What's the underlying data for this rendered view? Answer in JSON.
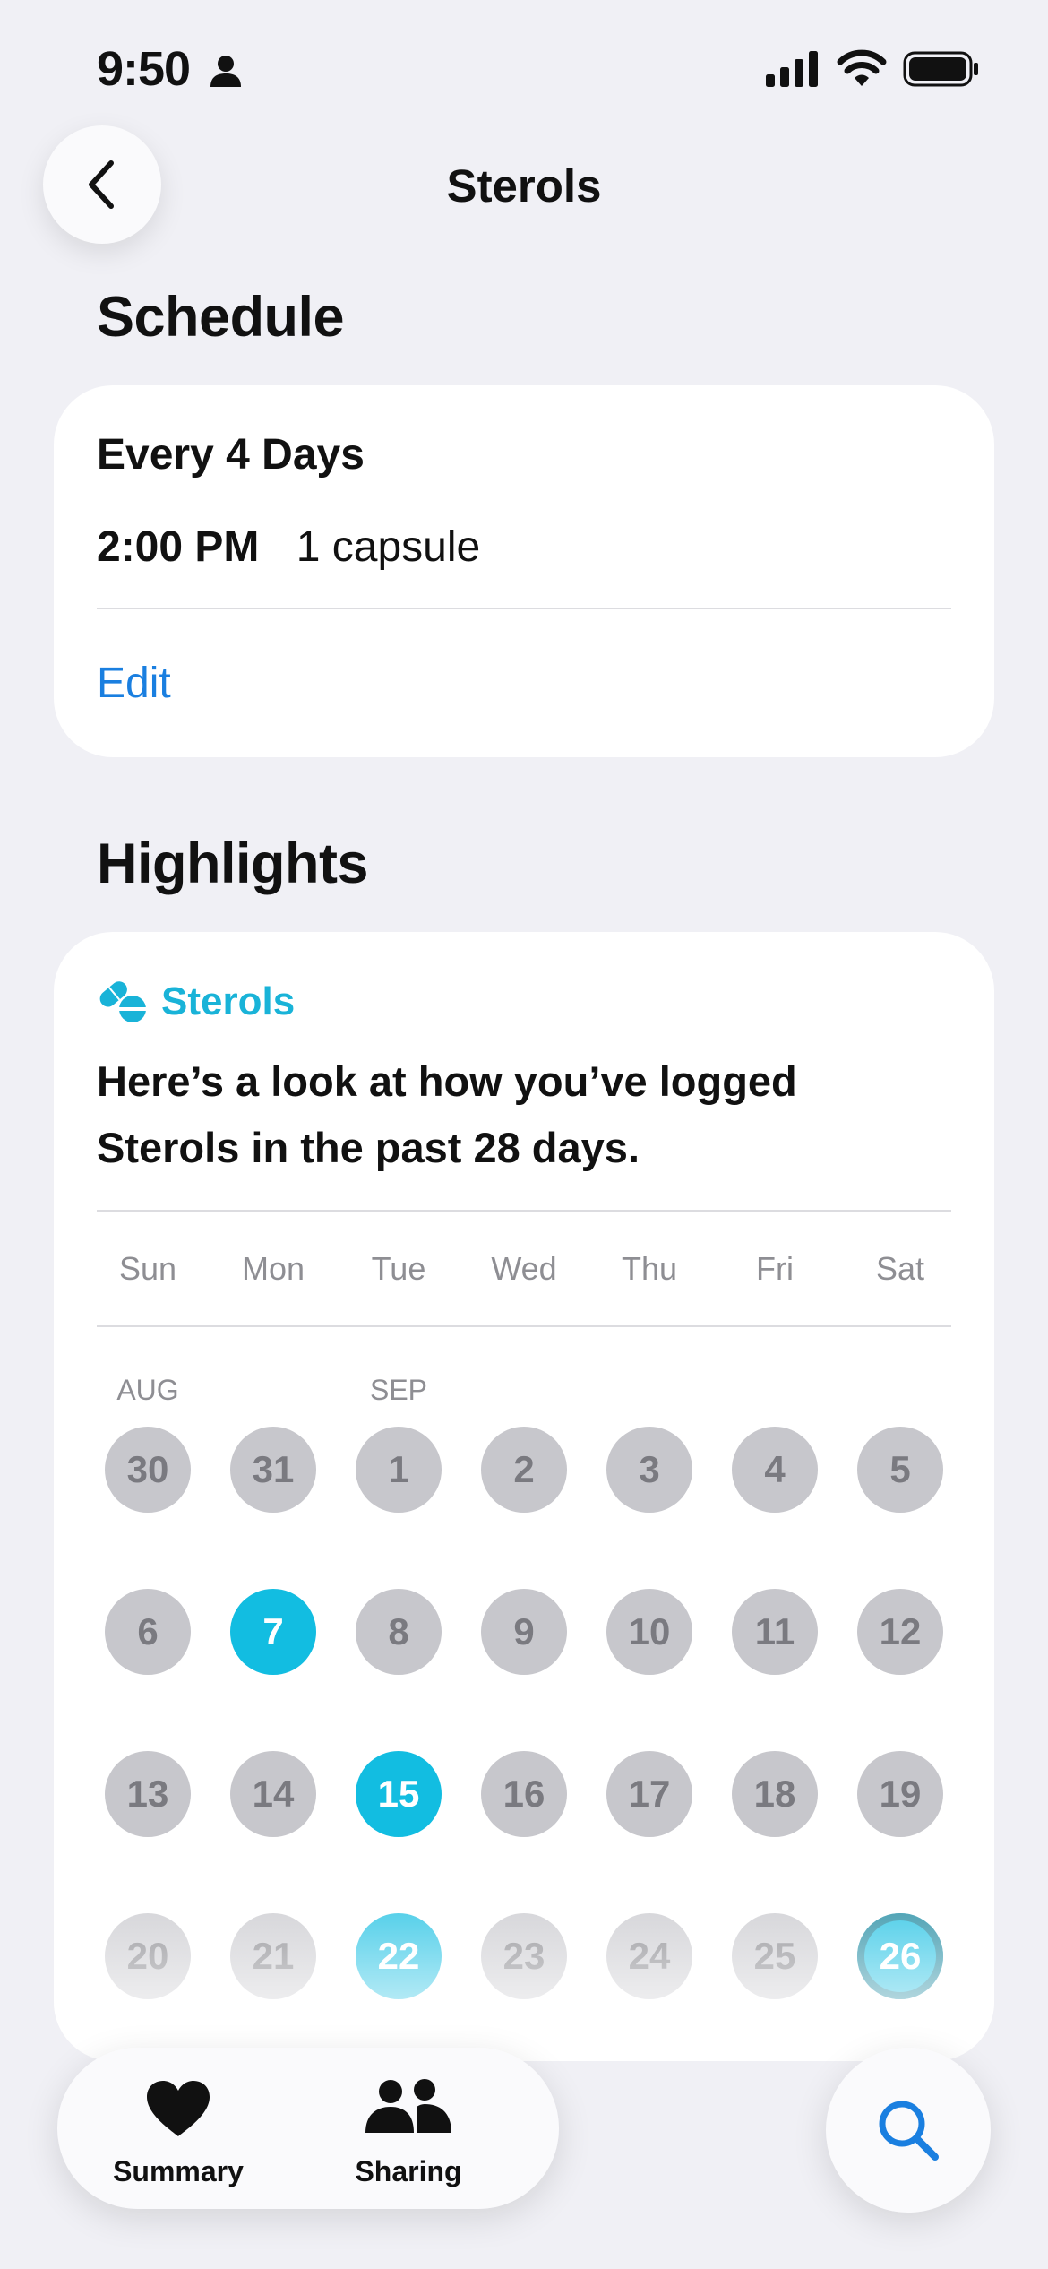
{
  "status_bar": {
    "time": "9:50"
  },
  "nav": {
    "title": "Sterols"
  },
  "schedule": {
    "section_title": "Schedule",
    "frequency": "Every 4 Days",
    "dose_time": "2:00 PM",
    "dose_amount": "1 capsule",
    "edit_label": "Edit"
  },
  "highlights": {
    "section_title": "Highlights",
    "medication_label": "Sterols",
    "description": "Here’s a look at how you’ve logged Sterols in the past 28 days.",
    "weekdays": [
      "Sun",
      "Mon",
      "Tue",
      "Wed",
      "Thu",
      "Fri",
      "Sat"
    ],
    "month_labels": [
      "AUG",
      "SEP"
    ],
    "weeks": [
      [
        "30",
        "31",
        "1",
        "2",
        "3",
        "4",
        "5"
      ],
      [
        "6",
        "7",
        "8",
        "9",
        "10",
        "11",
        "12"
      ],
      [
        "13",
        "14",
        "15",
        "16",
        "17",
        "18",
        "19"
      ],
      [
        "20",
        "21",
        "22",
        "23",
        "24",
        "25",
        "26"
      ]
    ],
    "logged_days": [
      "7",
      "15",
      "22",
      "26"
    ],
    "today": "26",
    "accent_color": "#12bde1"
  },
  "tab_bar": {
    "tabs": [
      {
        "label": "Summary",
        "icon": "heart-icon"
      },
      {
        "label": "Sharing",
        "icon": "people-icon"
      }
    ],
    "search_icon": "search-icon"
  }
}
